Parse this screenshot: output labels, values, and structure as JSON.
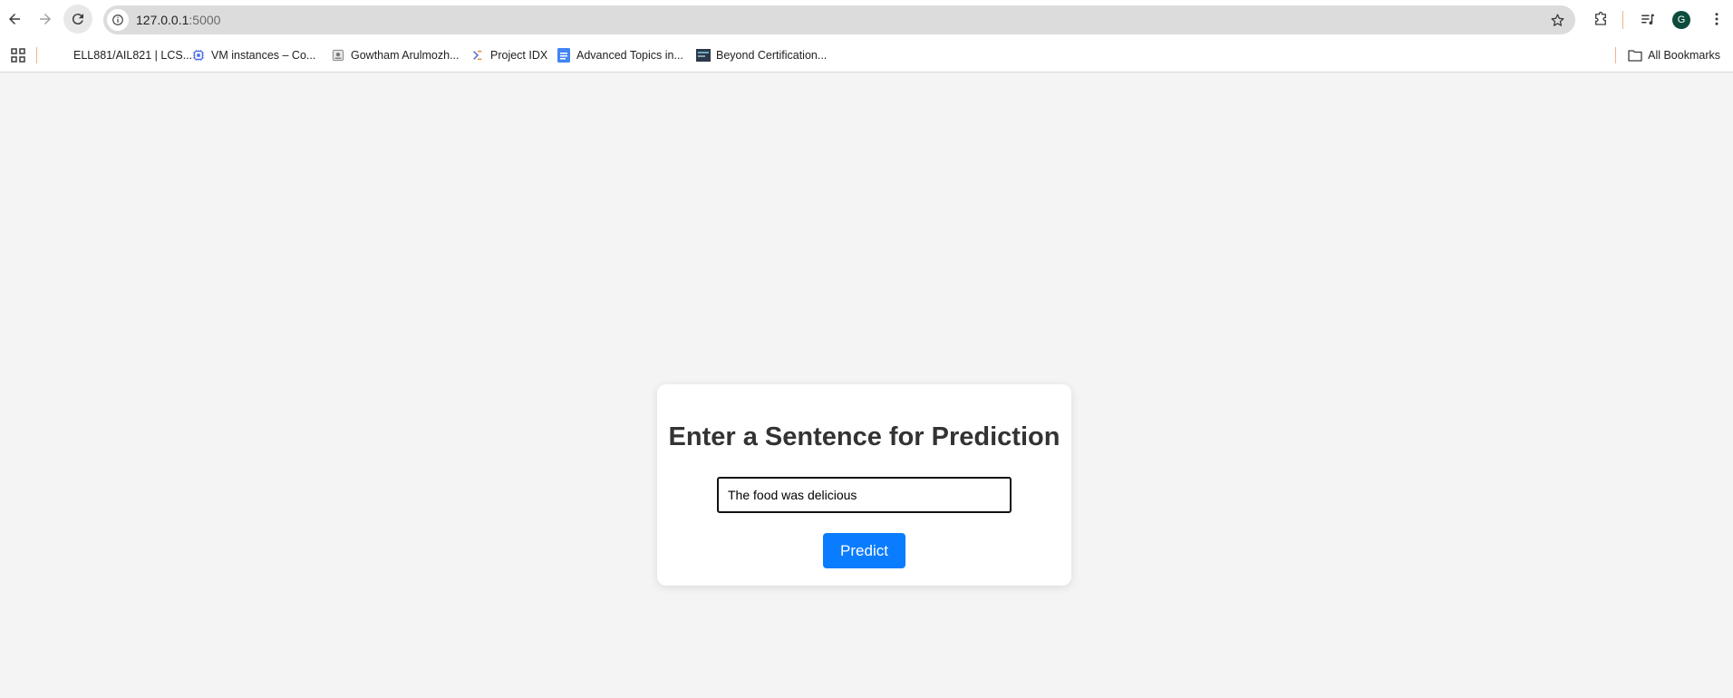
{
  "browser": {
    "url_host": "127.0.0.1",
    "url_port": ":5000",
    "profile_initial": "G",
    "icons": {
      "back": "arrow-left-icon",
      "forward": "arrow-right-icon",
      "reload": "reload-icon",
      "site_info": "info-icon",
      "bookmark": "star-icon",
      "extensions": "puzzle-icon",
      "media": "media-queue-icon",
      "menu": "kebab-menu-icon"
    }
  },
  "bookmarks": {
    "items": [
      {
        "label": "ELL881/AIL821 | LCS...",
        "icon": "blank-favicon"
      },
      {
        "label": "VM instances – Co...",
        "icon": "chip-icon"
      },
      {
        "label": "Gowtham Arulmozh...",
        "icon": "page-icon"
      },
      {
        "label": "Project IDX",
        "icon": "idx-icon"
      },
      {
        "label": "Advanced Topics in...",
        "icon": "docs-icon"
      },
      {
        "label": "Beyond Certification...",
        "icon": "image-favicon"
      }
    ],
    "all_label": "All Bookmarks"
  },
  "page": {
    "heading": "Enter a Sentence for Prediction",
    "input_value": "The food was delicious",
    "button_label": "Predict"
  },
  "colors": {
    "page_bg": "#f4f4f4",
    "button_bg": "#0a7cff",
    "avatar_bg": "#0d4b3c"
  }
}
